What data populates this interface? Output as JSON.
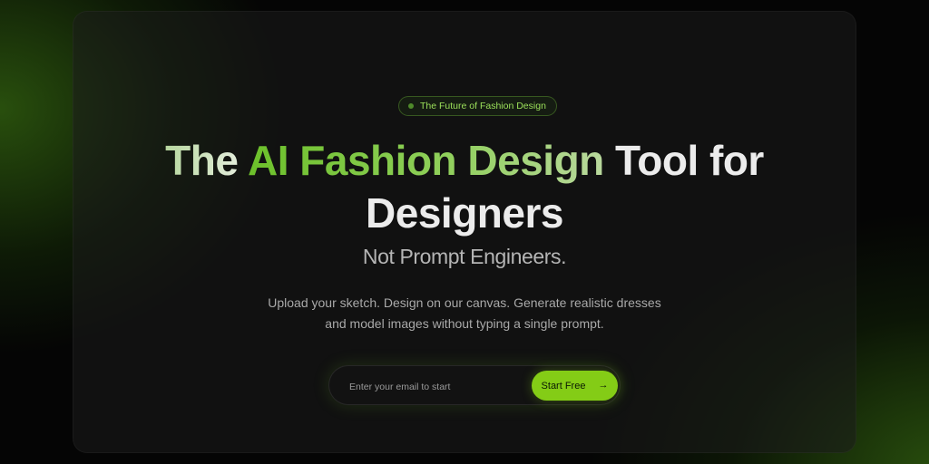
{
  "badge": {
    "text": "The Future of Fashion Design"
  },
  "hero": {
    "title_lead": "The ",
    "title_accent": "AI Fashion Design",
    "title_tail": " Tool for",
    "title_line2": "Designers",
    "subtitle": "Not Prompt Engineers.",
    "description_line1": "Upload your sketch. Design on our canvas. Generate realistic dresses",
    "description_line2": "and model images without typing a single prompt."
  },
  "signup": {
    "email_placeholder": "Enter your email to start",
    "email_value": "",
    "button_label": "Start Free",
    "button_icon": "arrow-right-icon"
  },
  "colors": {
    "accent": "#84cc16",
    "badge_text": "#9be05a",
    "background": "#050505"
  }
}
